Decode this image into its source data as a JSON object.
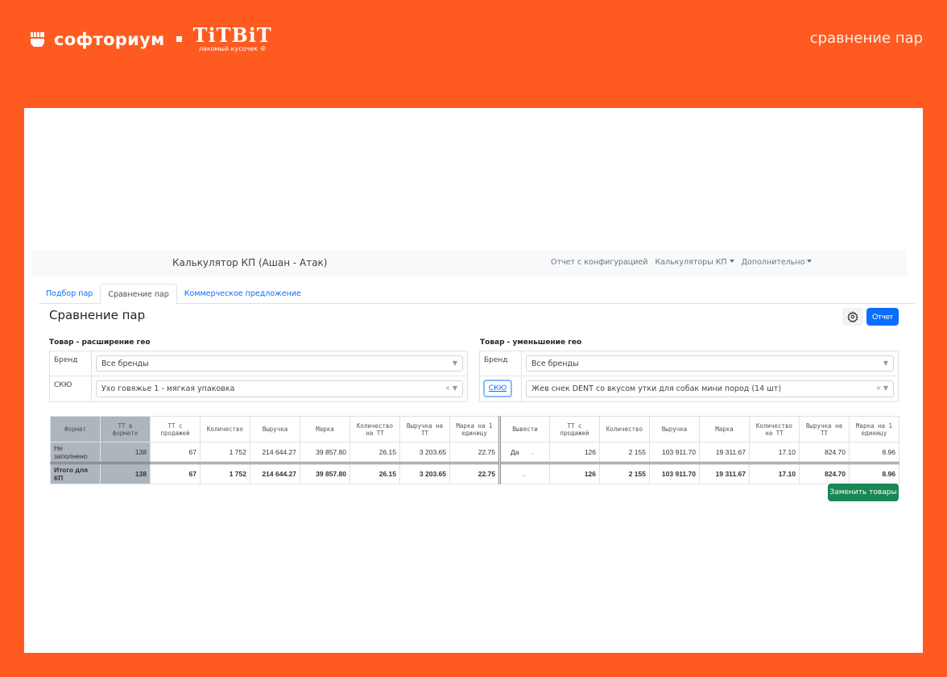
{
  "header": {
    "brand": "софториум",
    "partner_logo": "TiTBiT",
    "partner_tagline": "лакомый кусочек ®",
    "page_label": "сравнение пар"
  },
  "navbar": {
    "title": "Калькулятор КП (Ашан - Атак)",
    "links": [
      "Отчет с конфигурацией",
      "Калькуляторы КП",
      "Дополнительно"
    ]
  },
  "tabs": [
    "Подбор пар",
    "Сравнение пар",
    "Коммерческое предложение"
  ],
  "page": {
    "title": "Сравнение пар",
    "ellipsis": "...",
    "report_button": "Отчет",
    "replace_button": "Заменить товары"
  },
  "left": {
    "title": "Товар - расширение гео",
    "brand_label": "Бренд",
    "brand_value": "Все бренды",
    "sku_label": "СКЮ",
    "sku_value": "Ухо говяжье 1 - мягкая упаковка"
  },
  "right": {
    "title": "Товар - уменьшение гео",
    "brand_label": "Бренд",
    "brand_value": "Все бренды",
    "sku_label": "СКЮ",
    "sku_value": "Жев снек DENT со вкусом утки для собак мини пород (14 шт)"
  },
  "table": {
    "headers": [
      "Формат",
      "ТТ в формате",
      "ТТ с продажей",
      "Количество",
      "Выручка",
      "Марка",
      "Количество на ТТ",
      "Выручка на ТТ",
      "Марка на 1 единицу",
      "Вывести",
      "ТТ с продажей",
      "Количество",
      "Выручка",
      "Марка",
      "Количество на ТТ",
      "Выручка на ТТ",
      "Марка на 1 единицу"
    ],
    "rows": [
      [
        "Не заполнено",
        "138",
        "67",
        "1 752",
        "214 644.27",
        "39 857.80",
        "26.15",
        "3 203.65",
        "22.75",
        "Да",
        "126",
        "2 155",
        "103 911.70",
        "19 311.67",
        "17.10",
        "824.70",
        "8.96"
      ],
      [
        "Итого для КП",
        "138",
        "67",
        "1 752",
        "214 644.27",
        "39 857.80",
        "26.15",
        "3 203.65",
        "22.75",
        "",
        "126",
        "2 155",
        "103 911.70",
        "19 311.67",
        "17.10",
        "824.70",
        "8.96"
      ]
    ]
  }
}
